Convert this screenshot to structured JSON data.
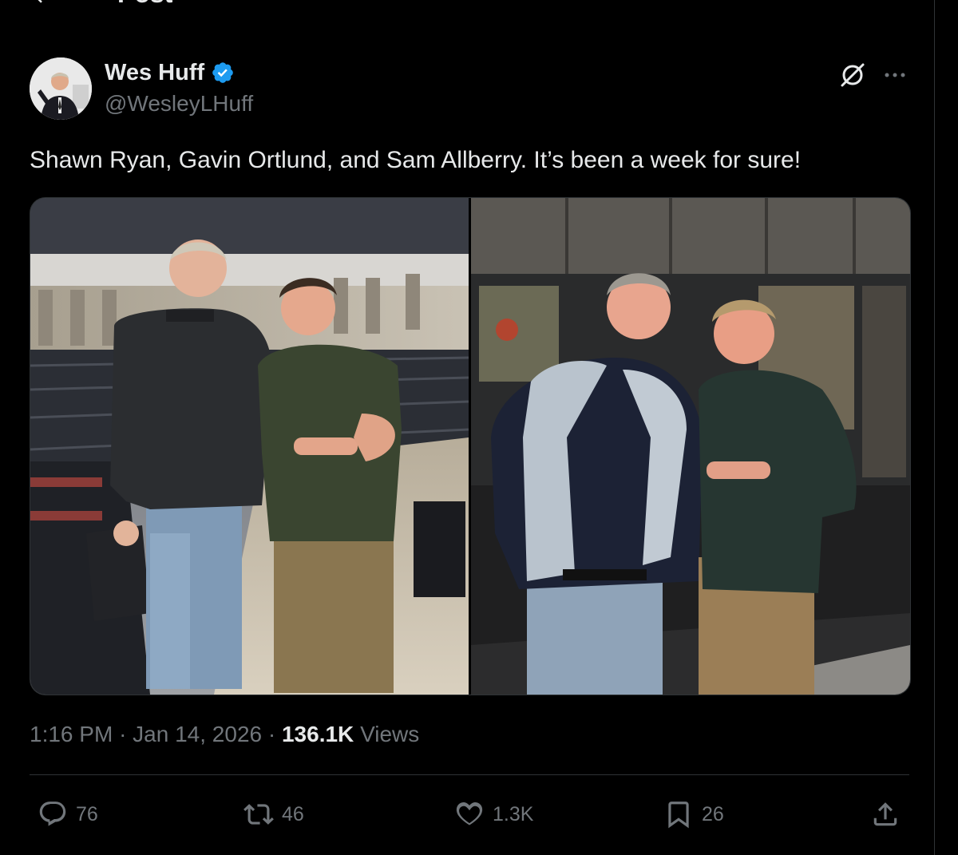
{
  "header": {
    "title": "Post"
  },
  "post": {
    "author": {
      "name": "Wes Huff",
      "handle": "@WesleyLHuff",
      "verified": true
    },
    "text": "Shawn Ryan, Gavin Ortlund, and Sam Allberry. It’s been a week for sure!",
    "time": "1:16 PM",
    "date": "Jan 14, 2026",
    "views_count": "136.1K",
    "views_label": "Views",
    "separator": "·"
  },
  "actions": {
    "replies": "76",
    "reposts": "46",
    "likes": "1.3K",
    "bookmarks": "26"
  },
  "colors": {
    "background": "#000000",
    "text_primary": "#e7e9ea",
    "text_secondary": "#71767b",
    "verified_blue": "#1d9bf0",
    "divider": "#2f3336"
  }
}
